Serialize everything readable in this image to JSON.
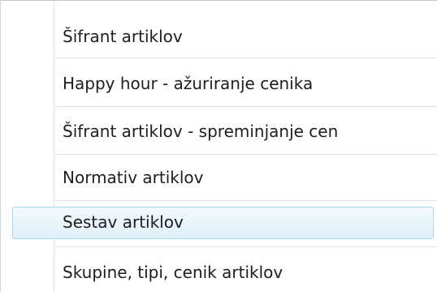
{
  "menu": {
    "items": [
      {
        "label": "Šifrant artiklov",
        "highlighted": false
      },
      {
        "label": "Happy hour - ažuriranje cenika",
        "highlighted": false
      },
      {
        "label": "Šifrant artiklov - spreminjanje cen",
        "highlighted": false
      },
      {
        "label": "Normativ artiklov",
        "highlighted": false
      },
      {
        "label": "Sestav artiklov",
        "highlighted": true
      },
      {
        "label": "Skupine, tipi, cenik artiklov",
        "highlighted": false
      }
    ]
  },
  "colors": {
    "highlight_border": "#a8d8eb",
    "highlight_fill": "#e0f0f8",
    "separator": "#e2e3e3",
    "text": "#1e1e1e"
  }
}
